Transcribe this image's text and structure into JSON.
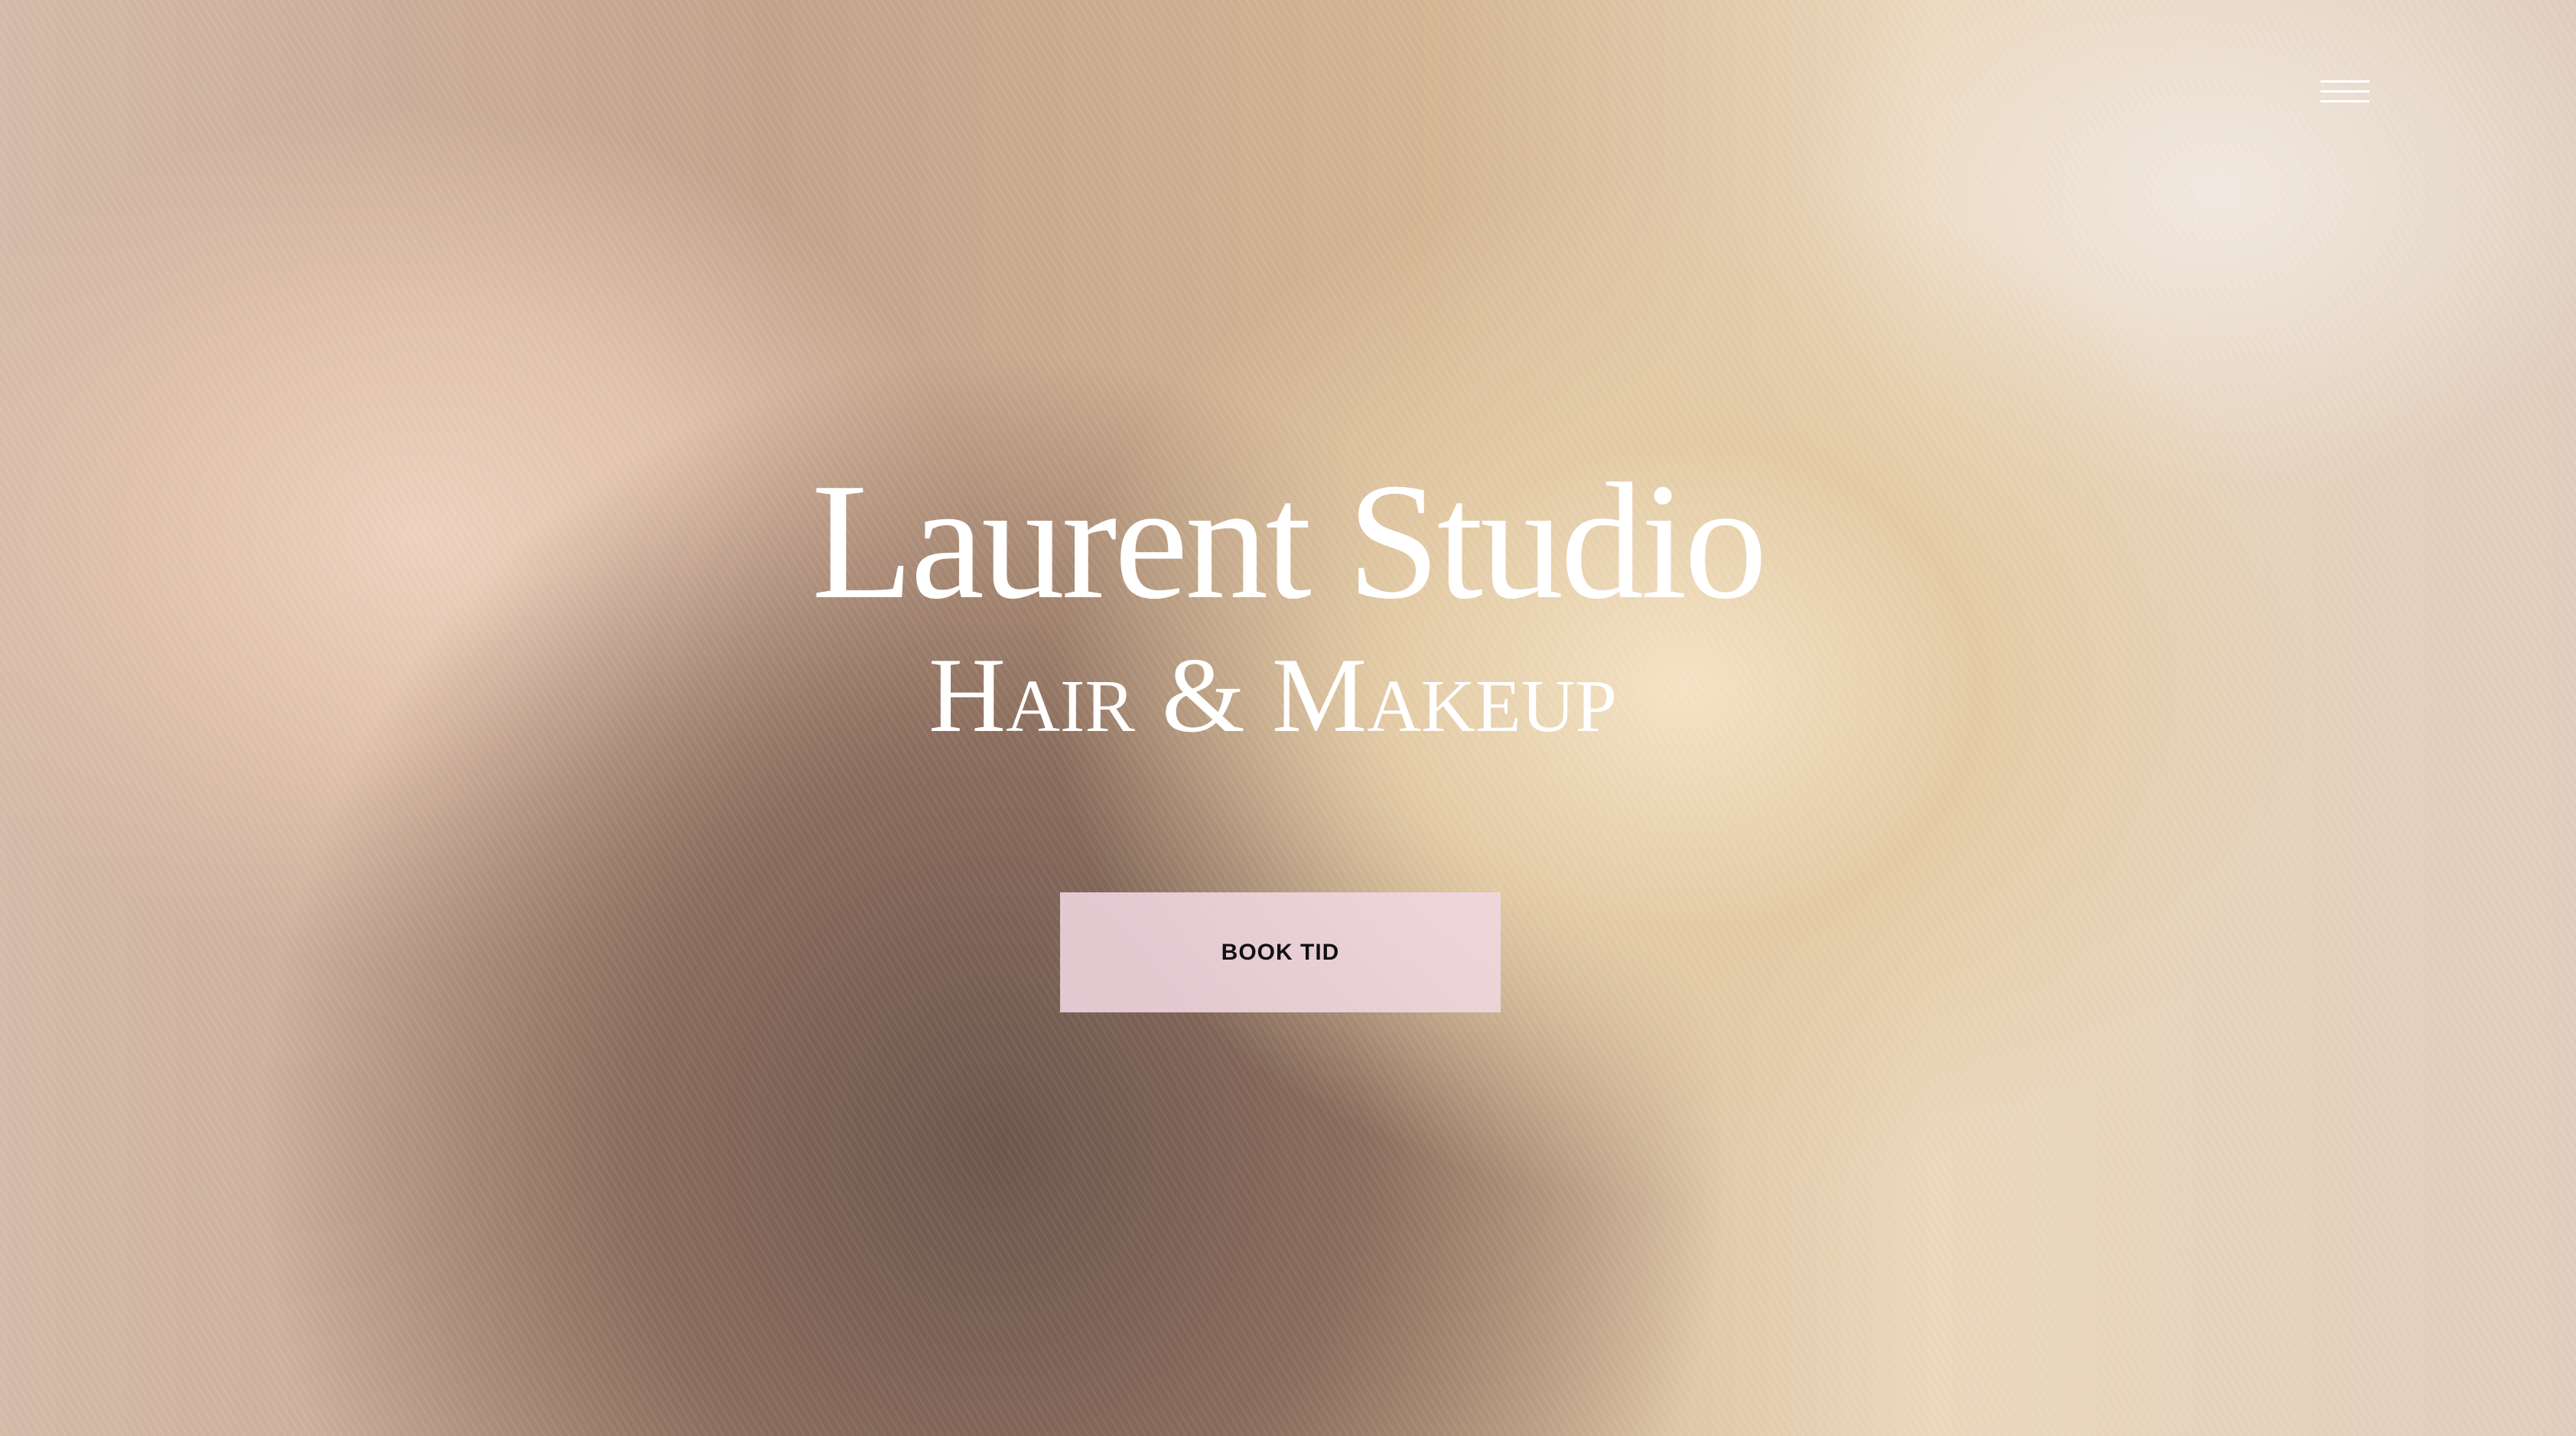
{
  "header": {
    "menu_icon": "hamburger-menu-icon"
  },
  "hero": {
    "background_image": "hair-stylist-cutting-blonde-hair",
    "title": "Laurent Studio",
    "subtitle": "Hair & Makeup",
    "cta_label": "BOOK TID",
    "cta_color": "#f0d7e1"
  }
}
